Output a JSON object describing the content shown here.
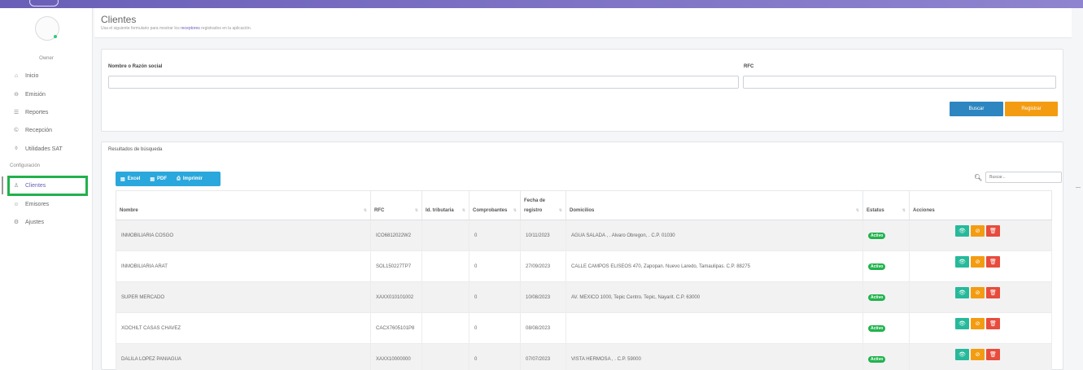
{
  "sidebar": {
    "role": "Owner",
    "items": [
      {
        "label": "Inicio",
        "icon": "home-icon",
        "glyph": "⌂"
      },
      {
        "label": "Emisión",
        "icon": "arrow-circle-icon",
        "glyph": "⊖"
      },
      {
        "label": "Reportes",
        "icon": "list-icon",
        "glyph": "☰"
      },
      {
        "label": "Recepción",
        "icon": "copyright-circle-icon",
        "glyph": "©"
      },
      {
        "label": "Utilidades SAT",
        "icon": "lifebuoy-icon",
        "glyph": "⌽"
      }
    ],
    "section_label": "Configuración",
    "config_items": [
      {
        "label": "Clientes",
        "icon": "user-icon",
        "glyph": "♙"
      },
      {
        "label": "Emisores",
        "icon": "users-icon",
        "glyph": "☺"
      },
      {
        "label": "Ajustes",
        "icon": "gear-icon",
        "glyph": "⚙"
      }
    ]
  },
  "header": {
    "title": "Clientes",
    "subtitle_before": "Usa el siguiente formulario para mostrar los",
    "subtitle_link": "receptores",
    "subtitle_after": "registrados en la aplicación."
  },
  "form": {
    "name_label": "Nombre o Razón social",
    "name_value": "",
    "rfc_label": "RFC",
    "rfc_value": "",
    "search_button": "Buscar",
    "register_button": "Registrar"
  },
  "results": {
    "title": "Resultados de búsqueda",
    "export": {
      "excel": "Excel",
      "pdf": "PDF",
      "print": "Imprimir"
    },
    "search_placeholder": "Buscar...",
    "columns": {
      "nombre": "Nombre",
      "rfc": "RFC",
      "id_tributaria": "Id. tributaria",
      "comprobantes": "Comprobantes",
      "fecha_line1": "Fecha de",
      "fecha_line2": "registro",
      "domicilios": "Domicilios",
      "estatus": "Estatus",
      "acciones": "Acciones"
    },
    "rows": [
      {
        "nombre": "INMOBILIARIA COSGO",
        "rfc": "ICO6812022W2",
        "id": "",
        "comprobantes": "0",
        "fecha": "10/11/2023",
        "domicilio": "AGUA SALADA , . Alvaro Obregon, . C.P. 01030",
        "estatus": "Activo"
      },
      {
        "nombre": "INMOBILIARIA ARAT",
        "rfc": "SOL150227TP7",
        "id": "",
        "comprobantes": "0",
        "fecha": "27/09/2023",
        "domicilio": "CALLE CAMPOS ELISEOS 470, Zapopan. Nuevo Laredo, Tamaulipas. C.P. 88275",
        "estatus": "Activo"
      },
      {
        "nombre": "SUPER MERCADO",
        "rfc": "XAXX010101002",
        "id": "",
        "comprobantes": "0",
        "fecha": "10/08/2023",
        "domicilio": "AV. MEXICO 1000, Tepic Centro. Tepic, Nayarit. C.P. 63000",
        "estatus": "Activo"
      },
      {
        "nombre": "XOCHILT CASAS CHAVEZ",
        "rfc": "CACX7605101P8",
        "id": "",
        "comprobantes": "0",
        "fecha": "08/08/2023",
        "domicilio": "",
        "estatus": "Activo"
      },
      {
        "nombre": "DALILA LOPEZ PANIAGUA",
        "rfc": "XAXX10000000",
        "id": "",
        "comprobantes": "0",
        "fecha": "07/07/2023",
        "domicilio": "VISTA HERMOSA , . C.P. 59000",
        "estatus": "Activo"
      }
    ]
  },
  "colors": {
    "brand": "#6a5fb8",
    "primary": "#2e86c1",
    "warning": "#f39c12",
    "success": "#21b34d",
    "danger": "#e74c3c",
    "teal": "#26b99a",
    "info": "#2aa7dc"
  }
}
